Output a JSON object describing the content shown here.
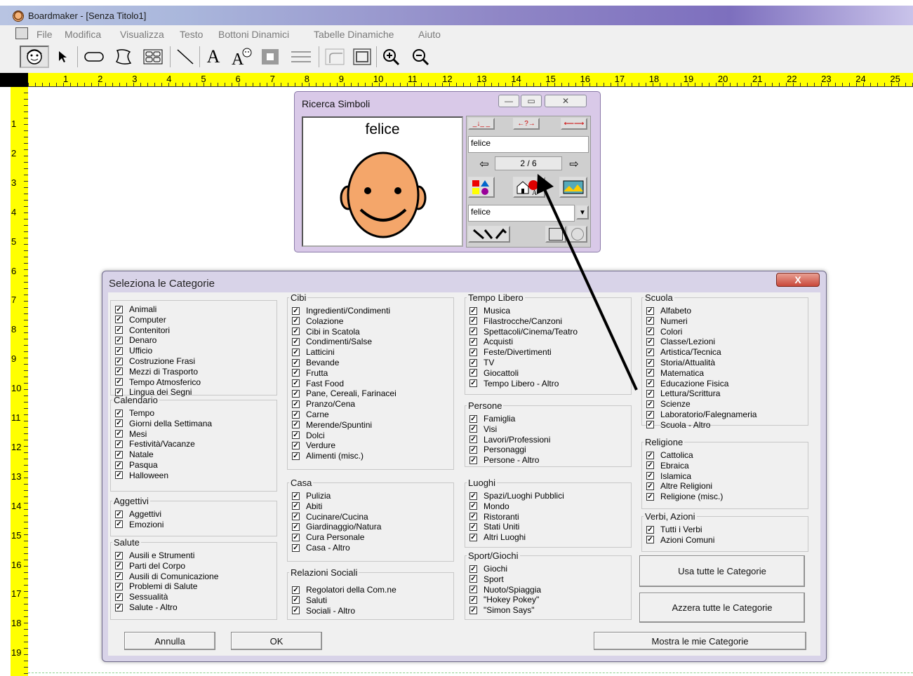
{
  "app": {
    "title": "Boardmaker - [Senza Titolo1]"
  },
  "menu": [
    "File",
    "Modifica",
    "Visualizza",
    "Testo",
    "Bottoni Dinamici",
    "Tabelle Dinamiche",
    "Aiuto"
  ],
  "ruler": {
    "h": [
      "1",
      "2",
      "3",
      "4",
      "5",
      "6",
      "7",
      "8",
      "9",
      "10",
      "11",
      "12",
      "13",
      "14",
      "15",
      "16",
      "17",
      "18",
      "19",
      "20",
      "21",
      "22",
      "23",
      "24",
      "25"
    ],
    "v": [
      "1",
      "2",
      "3",
      "4",
      "5",
      "6",
      "7",
      "8",
      "9",
      "10",
      "11",
      "12",
      "13",
      "14",
      "15",
      "16",
      "17",
      "18",
      "19"
    ]
  },
  "ricerca": {
    "title": "Ricerca Simboli",
    "symbol_word": "felice",
    "search_value": "felice",
    "counter": "2 / 6",
    "name_value": "felice"
  },
  "dialog": {
    "title": "Seleziona le Categorie",
    "close": "X",
    "col1_ungrouped": [
      "Animali",
      "Computer",
      "Contenitori",
      "Denaro",
      "Ufficio",
      "Costruzione Frasi",
      "Mezzi di Trasporto",
      "Tempo Atmosferico",
      "Lingua dei Segni"
    ],
    "calendario": {
      "legend": "Calendario",
      "items": [
        "Tempo",
        "Giorni della Settimana",
        "Mesi",
        "Festività/Vacanze",
        "Natale",
        "Pasqua",
        "Halloween"
      ]
    },
    "aggettivi": {
      "legend": "Aggettivi",
      "items": [
        "Aggettivi",
        "Emozioni"
      ]
    },
    "salute": {
      "legend": "Salute",
      "items": [
        "Ausili e Strumenti",
        "Parti del Corpo",
        "Ausili di Comunicazione",
        "Problemi di Salute",
        "Sessualità",
        "Salute - Altro"
      ]
    },
    "cibi": {
      "legend": "Cibi",
      "items": [
        "Ingredienti/Condimenti",
        "Colazione",
        "Cibi in Scatola",
        "Condimenti/Salse",
        "Latticini",
        "Bevande",
        "Frutta",
        "Fast Food",
        "Pane, Cereali, Farinacei",
        "Pranzo/Cena",
        "Carne",
        "Merende/Spuntini",
        "Dolci",
        "Verdure",
        "Alimenti (misc.)"
      ]
    },
    "casa": {
      "legend": "Casa",
      "items": [
        "Pulizia",
        "Abiti",
        "Cucinare/Cucina",
        "Giardinaggio/Natura",
        "Cura Personale",
        "Casa - Altro"
      ]
    },
    "relazioni": {
      "legend": "Relazioni Sociali",
      "items": [
        "Regolatori della Com.ne",
        "Saluti",
        "Sociali - Altro"
      ]
    },
    "tempolibero": {
      "legend": "Tempo Libero",
      "items": [
        "Musica",
        "Filastrocche/Canzoni",
        "Spettacoli/Cinema/Teatro",
        "Acquisti",
        "Feste/Divertimenti",
        "TV",
        "Giocattoli",
        "Tempo Libero - Altro"
      ]
    },
    "persone": {
      "legend": "Persone",
      "items": [
        "Famiglia",
        "Visi",
        "Lavori/Professioni",
        "Personaggi",
        "Persone - Altro"
      ]
    },
    "luoghi": {
      "legend": "Luoghi",
      "items": [
        "Spazi/Luoghi Pubblici",
        "Mondo",
        "Ristoranti",
        "Stati Uniti",
        "Altri Luoghi"
      ]
    },
    "sport": {
      "legend": "Sport/Giochi",
      "items": [
        "Giochi",
        "Sport",
        "Nuoto/Spiaggia",
        "\"Hokey Pokey\"",
        "\"Simon Says\""
      ]
    },
    "scuola": {
      "legend": "Scuola",
      "items": [
        "Alfabeto",
        "Numeri",
        "Colori",
        "Classe/Lezioni",
        "Artistica/Tecnica",
        "Storia/Attualità",
        "Matematica",
        "Educazione Fisica",
        "Lettura/Scrittura",
        "Scienze",
        "Laboratorio/Falegnameria",
        "Scuola - Altro"
      ]
    },
    "religione": {
      "legend": "Religione",
      "items": [
        "Cattolica",
        "Ebraica",
        "Islamica",
        "Altre Religioni",
        "Religione (misc.)"
      ]
    },
    "verbi": {
      "legend": "Verbi, Azioni",
      "items": [
        "Tutti i Verbi",
        "Azioni Comuni"
      ]
    },
    "buttons": {
      "usa": "Usa tutte le Categorie",
      "azzera": "Azzera tutte le Categorie",
      "annulla": "Annulla",
      "ok": "OK",
      "mostra": "Mostra le mie Categorie"
    }
  }
}
